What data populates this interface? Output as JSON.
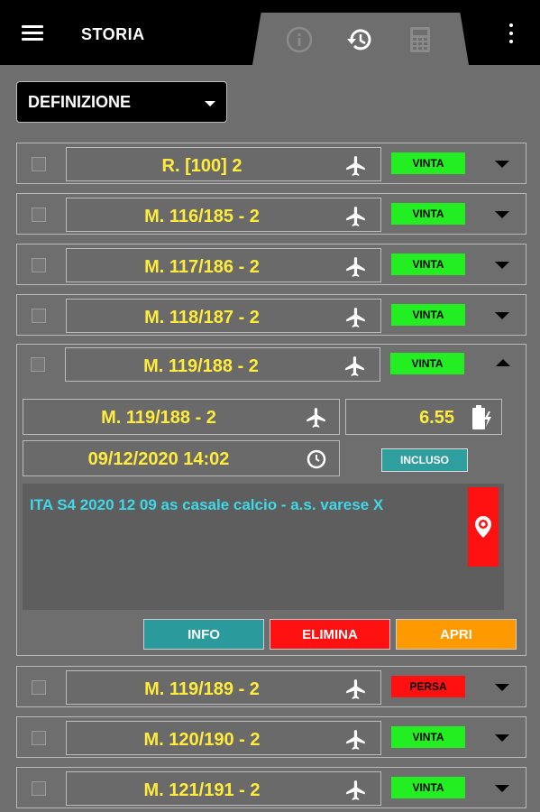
{
  "header": {
    "title": "STORIA",
    "tabs": [
      {
        "name": "info-tab",
        "icon": "info-icon"
      },
      {
        "name": "history-tab",
        "icon": "history-icon",
        "active": true
      },
      {
        "name": "calculator-tab",
        "icon": "calculator-icon"
      }
    ]
  },
  "filter": {
    "selected": "DEFINIZIONE"
  },
  "rows": [
    {
      "label": "R. [100] 2",
      "status": "VINTA"
    },
    {
      "label": "M. 116/185 - 2",
      "status": "VINTA"
    },
    {
      "label": "M. 117/186 - 2",
      "status": "VINTA"
    },
    {
      "label": "M. 118/187 - 2",
      "status": "VINTA"
    }
  ],
  "expanded": {
    "label": "M. 119/188 - 2",
    "status": "VINTA",
    "detail_label": "M. 119/188 - 2",
    "odds": "6.55",
    "datetime": "09/12/2020 14:02",
    "incluso": "INCLUSO",
    "description": "ITA S4 2020 12 09 as casale calcio - a.s. varese X",
    "actions": {
      "info": "INFO",
      "elimina": "ELIMINA",
      "apri": "APRI"
    }
  },
  "rows_after": [
    {
      "label": "M. 119/189 - 2",
      "status": "PERSA"
    },
    {
      "label": "M. 120/190 - 2",
      "status": "VINTA"
    },
    {
      "label": "M. 121/191 - 2",
      "status": "VINTA"
    }
  ],
  "colors": {
    "win": "#22ee22",
    "lose": "#ff1111",
    "label": "#ffeb3b",
    "description": "#3fd8e8",
    "info_button": "#2b9a9d",
    "delete_button": "#ff1111",
    "open_button": "#ff9900"
  }
}
